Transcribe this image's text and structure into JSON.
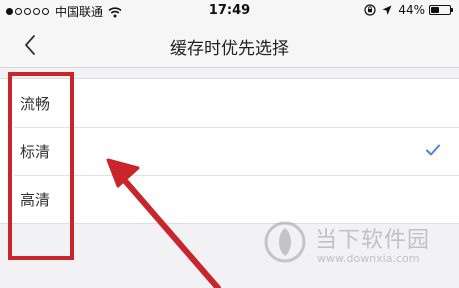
{
  "status_bar": {
    "carrier": "中国联通",
    "time": "17:49",
    "battery_text": "44%",
    "battery_level": 0.44,
    "signal_strength": 1,
    "icons": [
      "signal-dots",
      "wifi-icon",
      "orientation-lock-icon",
      "location-icon",
      "battery-icon"
    ]
  },
  "nav": {
    "back_icon": "chevron-left-icon",
    "title": "缓存时优先选择"
  },
  "options": [
    {
      "label": "流畅",
      "selected": false
    },
    {
      "label": "标清",
      "selected": true
    },
    {
      "label": "高清",
      "selected": false
    }
  ],
  "check_color": "#4a86d6",
  "annotation": {
    "color": "#c8262b",
    "shapes": [
      "highlight-box",
      "red-arrow"
    ]
  },
  "watermark": {
    "title": "当下软件园",
    "url": "www.downxia.com"
  }
}
